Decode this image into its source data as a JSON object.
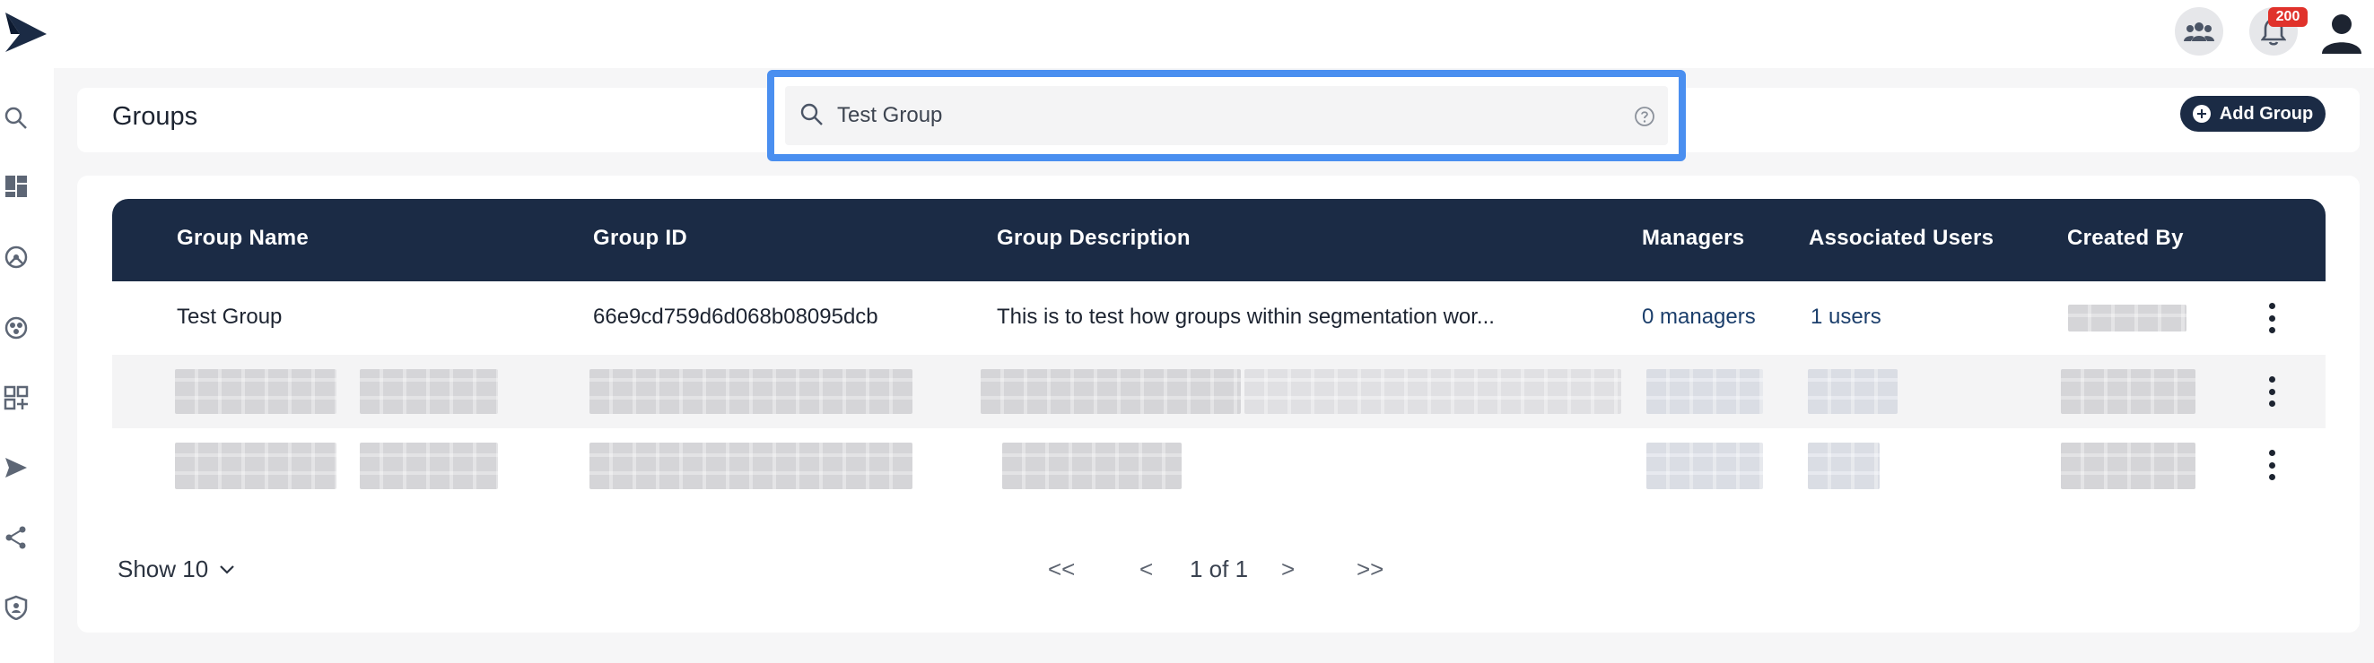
{
  "header": {
    "notification_count": "200"
  },
  "page": {
    "title": "Groups",
    "add_group_label": "Add Group"
  },
  "search": {
    "value": "Test Group",
    "placeholder": "Search"
  },
  "table": {
    "columns": [
      "Group Name",
      "Group ID",
      "Group Description",
      "Managers",
      "Associated Users",
      "Created By"
    ],
    "rows": [
      {
        "group_name": "Test Group",
        "group_id": "66e9cd759d6d068b08095dcb",
        "description": "This is to test how groups within segmentation wor...",
        "managers": "0 managers",
        "associated_users": "1 users",
        "created_by": ""
      }
    ]
  },
  "pagination": {
    "show_label": "Show 10",
    "first": "<<",
    "prev": "<",
    "page_info": "1 of 1",
    "next": ">",
    "last": ">>"
  },
  "colors": {
    "accent": "#1b2b45",
    "focus_outline": "#4a8ff0",
    "badge": "#e0322b"
  },
  "icons": {
    "sidebar": [
      "search-icon",
      "dashboard-icon",
      "analytics-icon",
      "segments-icon",
      "add-widget-icon",
      "send-icon",
      "share-icon",
      "shield-icon"
    ]
  }
}
